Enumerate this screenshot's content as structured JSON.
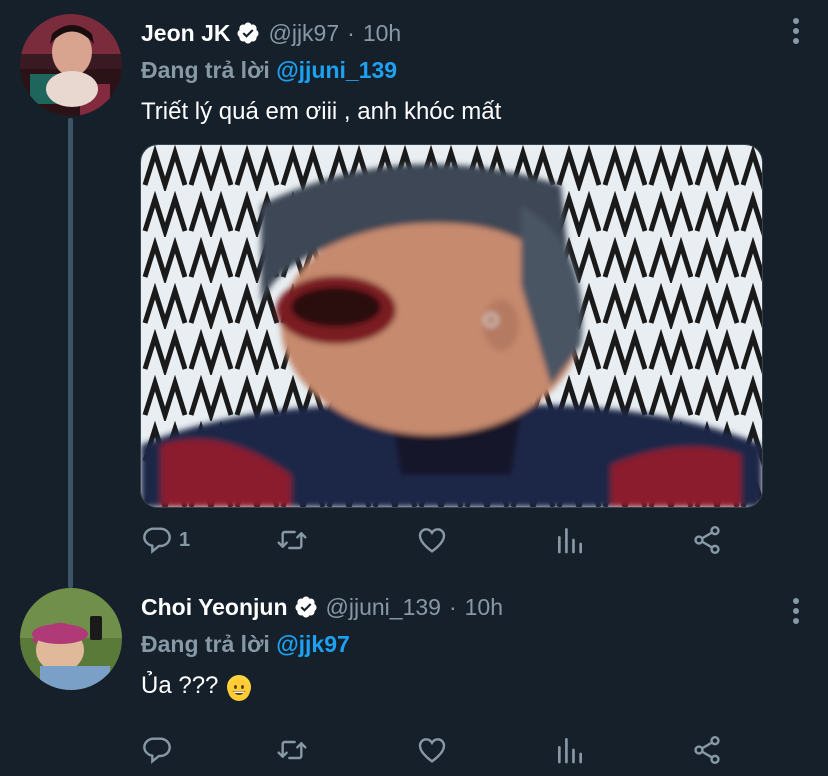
{
  "tweets": [
    {
      "name": "Jeon JK",
      "handle": "@jjk97",
      "separator": "·",
      "time": "10h",
      "replying_prefix": "Đang trả lời ",
      "replying_to": "@jjuni_139",
      "text": "Triết lý quá em ơiii , anh khóc mất",
      "reply_count": "1"
    },
    {
      "name": "Choi Yeonjun",
      "handle": "@jjuni_139",
      "separator": "·",
      "time": "10h",
      "replying_prefix": "Đang trả lời ",
      "replying_to": "@jjk97",
      "text": "Ủa ???",
      "emoji": "grinning-face-emoji"
    }
  ],
  "icons": {
    "reply": "reply-icon",
    "retweet": "retweet-icon",
    "like": "like-icon",
    "analytics": "analytics-icon",
    "share": "share-icon",
    "verified": "verified-badge-icon",
    "more": "more-options-icon"
  },
  "colors": {
    "background": "#15202b",
    "secondary_text": "#8899a6",
    "accent": "#1da1f2",
    "thread_line": "#3d5466"
  }
}
